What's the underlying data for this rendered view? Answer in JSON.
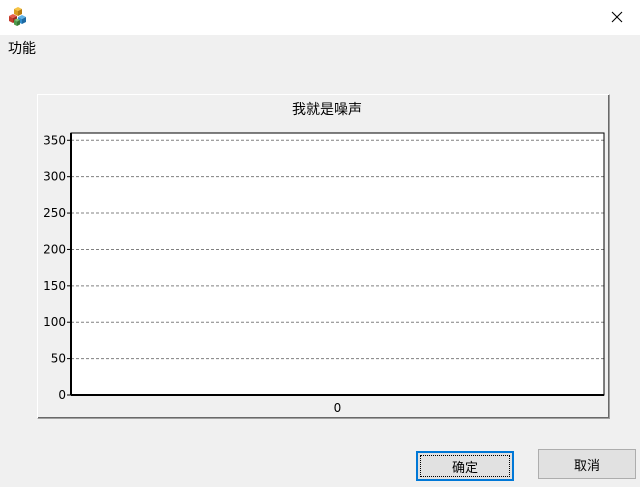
{
  "window": {
    "app_icon": "cubes-icon",
    "close_icon": "close-icon"
  },
  "menu": {
    "label": "功能"
  },
  "chart_data": {
    "type": "line",
    "title": "我就是噪声",
    "xlabel": "",
    "ylabel": "",
    "x_ticks": [
      "0"
    ],
    "y_ticks": [
      "0",
      "50",
      "100",
      "150",
      "200",
      "250",
      "300",
      "350"
    ],
    "ylim": [
      0,
      360
    ],
    "grid": true,
    "series": []
  },
  "buttons": {
    "ok_label": "确定",
    "cancel_label": "取消"
  }
}
